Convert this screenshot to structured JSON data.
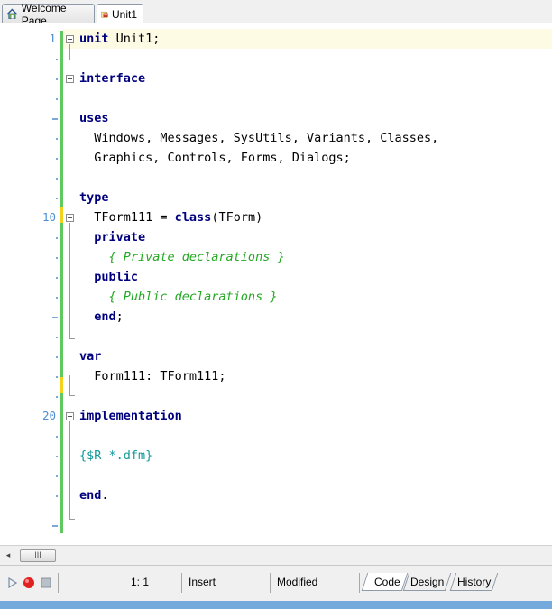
{
  "tabs": [
    {
      "label": "Welcome Page",
      "icon": "house-icon",
      "active": false
    },
    {
      "label": "Unit1",
      "icon": "unit-file-icon",
      "active": true
    }
  ],
  "editor": {
    "line_numbers": [
      "1",
      "10",
      "20"
    ],
    "lines": [
      {
        "parts": [
          {
            "t": "unit ",
            "c": "kw"
          },
          {
            "t": "Unit1;",
            "c": ""
          }
        ]
      },
      {
        "parts": []
      },
      {
        "parts": [
          {
            "t": "interface",
            "c": "kw"
          }
        ]
      },
      {
        "parts": []
      },
      {
        "parts": [
          {
            "t": "uses",
            "c": "kw"
          }
        ]
      },
      {
        "parts": [
          {
            "t": "  Windows, Messages, SysUtils, Variants, Classes,",
            "c": ""
          }
        ]
      },
      {
        "parts": [
          {
            "t": "  Graphics, Controls, Forms, Dialogs;",
            "c": ""
          }
        ]
      },
      {
        "parts": []
      },
      {
        "parts": [
          {
            "t": "type",
            "c": "kw"
          }
        ]
      },
      {
        "parts": [
          {
            "t": "  TForm111 = ",
            "c": ""
          },
          {
            "t": "class",
            "c": "kw"
          },
          {
            "t": "(TForm)",
            "c": ""
          }
        ]
      },
      {
        "parts": [
          {
            "t": "  private",
            "c": "kw"
          }
        ]
      },
      {
        "parts": [
          {
            "t": "    { Private declarations }",
            "c": "cm"
          }
        ]
      },
      {
        "parts": [
          {
            "t": "  public",
            "c": "kw"
          }
        ]
      },
      {
        "parts": [
          {
            "t": "    { Public declarations }",
            "c": "cm"
          }
        ]
      },
      {
        "parts": [
          {
            "t": "  end",
            "c": "kw"
          },
          {
            "t": ";",
            "c": ""
          }
        ]
      },
      {
        "parts": []
      },
      {
        "parts": [
          {
            "t": "var",
            "c": "kw"
          }
        ]
      },
      {
        "parts": [
          {
            "t": "  Form111: TForm111;",
            "c": ""
          }
        ]
      },
      {
        "parts": []
      },
      {
        "parts": [
          {
            "t": "implementation",
            "c": "kw"
          }
        ]
      },
      {
        "parts": []
      },
      {
        "parts": [
          {
            "t": "{$R *.dfm}",
            "c": "dir"
          }
        ]
      },
      {
        "parts": []
      },
      {
        "parts": [
          {
            "t": "end",
            "c": "kw"
          },
          {
            "t": ".",
            "c": ""
          }
        ]
      },
      {
        "parts": []
      }
    ]
  },
  "scrollbar": {
    "thumb_label": "III",
    "left_arrow": "◂"
  },
  "status": {
    "position": "1: 1",
    "mode": "Insert",
    "state": "Modified"
  },
  "bottom_tabs": [
    {
      "label": "Code",
      "active": true
    },
    {
      "label": "Design",
      "active": false
    },
    {
      "label": "History",
      "active": false
    }
  ],
  "colors": {
    "accent_blue": "#4d8fd6",
    "modified_green": "#5fc85f",
    "keyword": "#00007f",
    "comment": "#22a822"
  }
}
